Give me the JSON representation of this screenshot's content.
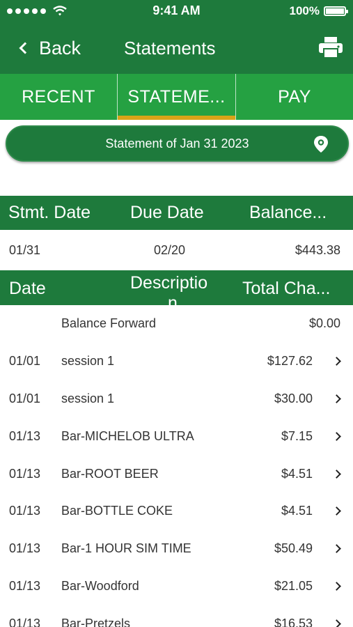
{
  "status_bar": {
    "time": "9:41 AM",
    "battery": "100%"
  },
  "nav": {
    "back_label": "Back",
    "title": "Statements"
  },
  "tabs": [
    {
      "label": "RECENT",
      "active": false
    },
    {
      "label": "STATEME...",
      "active": true
    },
    {
      "label": "PAY",
      "active": false
    }
  ],
  "selector": {
    "label": "Statement of Jan 31 2023"
  },
  "summary": {
    "headers": {
      "stmt_date": "Stmt. Date",
      "due_date": "Due Date",
      "balance": "Balance..."
    },
    "row": {
      "stmt_date": "01/31",
      "due_date": "02/20",
      "balance": "$443.38"
    }
  },
  "transactions": {
    "headers": {
      "date": "Date",
      "description": "Descriptio",
      "description_wrap": "n",
      "total": "Total Cha..."
    },
    "rows": [
      {
        "date": "",
        "description": "Balance Forward",
        "amount": "$0.00"
      },
      {
        "date": "01/01",
        "description": "session 1",
        "amount": "$127.62"
      },
      {
        "date": "01/01",
        "description": "session 1",
        "amount": "$30.00"
      },
      {
        "date": "01/13",
        "description": "Bar-MICHELOB ULTRA",
        "amount": "$7.15"
      },
      {
        "date": "01/13",
        "description": "Bar-ROOT BEER",
        "amount": "$4.51"
      },
      {
        "date": "01/13",
        "description": "Bar-BOTTLE COKE",
        "amount": "$4.51"
      },
      {
        "date": "01/13",
        "description": "Bar-1 HOUR SIM TIME",
        "amount": "$50.49"
      },
      {
        "date": "01/13",
        "description": "Bar-Woodford",
        "amount": "$21.05"
      },
      {
        "date": "01/13",
        "description": "Bar-Pretzels",
        "amount": "$16.53"
      }
    ]
  },
  "colors": {
    "dark_green": "#1e7a3c",
    "tab_green": "#25a142",
    "active_tab_underline": "#d9a418"
  },
  "icons": {
    "back": "chevron-left-icon",
    "print": "printer-icon",
    "selector": "location-pin-icon",
    "row": "chevron-right-icon"
  }
}
